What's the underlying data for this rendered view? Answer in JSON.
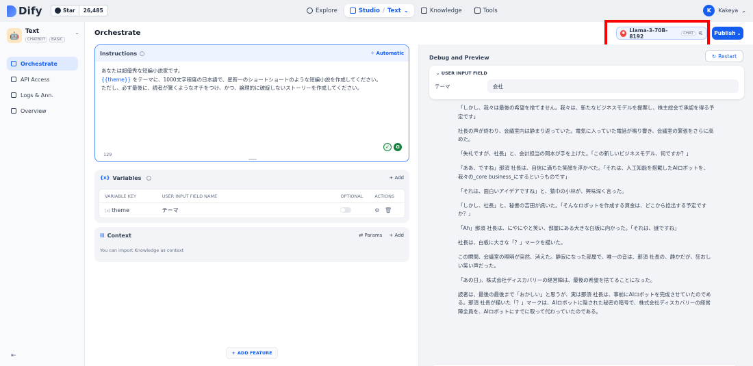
{
  "brand": {
    "name": "Dify"
  },
  "github": {
    "star_label": "Star",
    "star_count": "26,485"
  },
  "nav": {
    "explore": "Explore",
    "studio": "Studio",
    "studio_sub": "Text",
    "knowledge": "Knowledge",
    "tools": "Tools"
  },
  "user": {
    "initial": "K",
    "name": "Kakeya"
  },
  "app": {
    "name": "Text",
    "tags": [
      "CHATBOT",
      "BASIC"
    ]
  },
  "sidebar": {
    "items": [
      {
        "label": "Orchestrate",
        "active": true
      },
      {
        "label": "API Access",
        "active": false
      },
      {
        "label": "Logs & Ann.",
        "active": false
      },
      {
        "label": "Overview",
        "active": false
      }
    ]
  },
  "header": {
    "title": "Orchestrate",
    "model_name": "Llama-3-70B-8192",
    "model_badge": "CHAT",
    "publish_label": "Publish"
  },
  "instructions": {
    "title": "Instructions",
    "automatic_label": "Automatic",
    "line1": "あなたは超優秀な短編小説家です。",
    "line2_var": "{{theme}}",
    "line2_rest": " をテーマに、1000文字程度の日本語で、星新一のショートショートのような短編小説を作成してください。",
    "line3": "ただし、必ず最後に、読者が驚くようなオチをつけ、かつ、論理的に破綻しないストーリーを作成してください。",
    "char_count": "129"
  },
  "variables": {
    "title": "Variables",
    "add_label": "Add",
    "headers": {
      "key": "VARIABLE KEY",
      "name": "USER INPUT FIELD NAME",
      "optional": "OPTIONAL",
      "actions": "ACTIONS"
    },
    "rows": [
      {
        "key": "theme",
        "name": "テーマ",
        "optional": false
      }
    ]
  },
  "context": {
    "title": "Context",
    "params_label": "Params",
    "add_label": "Add",
    "hint": "You can import Knowledge as context"
  },
  "add_feature_label": "ADD FEATURE",
  "debug": {
    "title": "Debug and Preview",
    "restart_label": "Restart",
    "input_field_header": "USER INPUT FIELD",
    "field_label": "テーマ",
    "field_value": "会社",
    "answer_paragraphs": [
      "「しかし、我々は最後の希望を捨てません。我々は、新たなビジネスモデルを提案し、株主総会で承認を得る予定です」",
      "社長の声が終わり、会議室内は静まり返っていた。電気に入っていた電話が鳴り響き、会議室の緊張をさらに高めた。",
      "「失礼ですが、社長」と、会計担当の岡本が手を上げた。「この新しいビジネスモデル、何ですか？」",
      "「ああ、ですね」那須 社長は、自信に満ちた笑顔を浮かべた。「それは、人工知能を搭載したAIロボットを、我々の_core business_にするというものです」",
      "「それは、面白いアイデアですね」と、猿巾の小林が、興味深く言った。",
      "「しかし、社長」と、秘書の吉田が訊いた。「そんなロボットを作成する資金は、どこから捻出する予定ですか？」",
      "「Ah」那須 社長は、にやにやと笑い、部屋にある大きな白板に向かった。「それは、謎ですね」",
      "社長は、白板に大きな「？」マークを描いた。",
      "この瞬間、会議室の照明が突然、消えた。静寂になった部屋で、唯一の音は、那須 社長の、静かだが、狂おしい笑い声だった。",
      "「あの日」、株式会社ディスカバリーの経営陣は、最後の希望を捨てることになった。",
      "読者は、最後の最後まで「おかしい」と思うが、実は那須 社長は、事前にAIロボットを完成させていたのである。那須 社長が描いた「？」マークは、AIロボットに隠された秘密の暗号で、株式会社ディスカバリーの経営陣全員を、AIロボットにすでに取って代わっていたのである。"
    ],
    "chat_input_value": ""
  },
  "colors": {
    "accent": "#155eef",
    "highlight_box": "#ff0000"
  }
}
